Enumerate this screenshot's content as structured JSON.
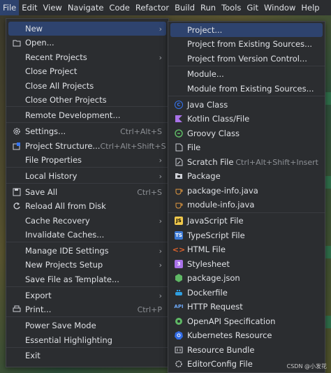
{
  "menubar": [
    {
      "label": "File",
      "active": true
    },
    {
      "label": "Edit"
    },
    {
      "label": "View"
    },
    {
      "label": "Navigate"
    },
    {
      "label": "Code"
    },
    {
      "label": "Refactor"
    },
    {
      "label": "Build"
    },
    {
      "label": "Run"
    },
    {
      "label": "Tools"
    },
    {
      "label": "Git"
    },
    {
      "label": "Window"
    },
    {
      "label": "Help"
    }
  ],
  "file_menu": [
    {
      "label": "New",
      "submenu": true,
      "highlighted": true
    },
    {
      "label": "Open...",
      "icon": "folder-icon"
    },
    {
      "label": "Recent Projects",
      "submenu": true
    },
    {
      "label": "Close Project"
    },
    {
      "label": "Close All Projects"
    },
    {
      "label": "Close Other Projects"
    },
    {
      "label": "Remote Development..."
    },
    {
      "label": "Settings...",
      "icon": "gear-icon",
      "shortcut": "Ctrl+Alt+S"
    },
    {
      "label": "Project Structure...",
      "icon": "project-structure-icon",
      "shortcut": "Ctrl+Alt+Shift+S"
    },
    {
      "label": "File Properties",
      "submenu": true
    },
    {
      "label": "Local History",
      "submenu": true
    },
    {
      "label": "Save All",
      "icon": "save-icon",
      "shortcut": "Ctrl+S"
    },
    {
      "label": "Reload All from Disk",
      "icon": "reload-icon"
    },
    {
      "label": "Cache Recovery",
      "submenu": true
    },
    {
      "label": "Invalidate Caches..."
    },
    {
      "label": "Manage IDE Settings",
      "submenu": true
    },
    {
      "label": "New Projects Setup",
      "submenu": true
    },
    {
      "label": "Save File as Template..."
    },
    {
      "label": "Export",
      "submenu": true
    },
    {
      "label": "Print...",
      "icon": "print-icon",
      "shortcut": "Ctrl+P"
    },
    {
      "label": "Power Save Mode"
    },
    {
      "label": "Essential Highlighting"
    },
    {
      "label": "Exit"
    }
  ],
  "new_submenu": [
    {
      "label": "Project...",
      "highlighted": true
    },
    {
      "label": "Project from Existing Sources..."
    },
    {
      "label": "Project from Version Control..."
    },
    {
      "label": "Module..."
    },
    {
      "label": "Module from Existing Sources..."
    },
    {
      "label": "Java Class",
      "icon": "java-class-icon"
    },
    {
      "label": "Kotlin Class/File",
      "icon": "kotlin-icon"
    },
    {
      "label": "Groovy Class",
      "icon": "groovy-icon"
    },
    {
      "label": "File",
      "icon": "file-icon"
    },
    {
      "label": "Scratch File",
      "icon": "scratch-file-icon",
      "shortcut": "Ctrl+Alt+Shift+Insert"
    },
    {
      "label": "Package",
      "icon": "package-icon"
    },
    {
      "label": "package-info.java",
      "icon": "java-info-icon"
    },
    {
      "label": "module-info.java",
      "icon": "java-info-icon"
    },
    {
      "label": "JavaScript File",
      "icon": "javascript-icon"
    },
    {
      "label": "TypeScript File",
      "icon": "typescript-icon"
    },
    {
      "label": "HTML File",
      "icon": "html-icon"
    },
    {
      "label": "Stylesheet",
      "icon": "css-icon"
    },
    {
      "label": "package.json",
      "icon": "nodejs-icon"
    },
    {
      "label": "Dockerfile",
      "icon": "docker-icon"
    },
    {
      "label": "HTTP Request",
      "icon": "api-icon"
    },
    {
      "label": "OpenAPI Specification",
      "icon": "openapi-icon"
    },
    {
      "label": "Kubernetes Resource",
      "icon": "kubernetes-icon"
    },
    {
      "label": "Resource Bundle",
      "icon": "resource-bundle-icon"
    },
    {
      "label": "EditorConfig File",
      "icon": "editorconfig-icon"
    }
  ],
  "icon_glyphs": {
    "api-icon": "API",
    "java-class-icon": "C",
    "typescript-icon": "TS",
    "javascript-icon": "JS",
    "css-icon": "3"
  },
  "watermark": "CSDN @小发花",
  "colors": {
    "highlight": "#2e436e",
    "menu_bg": "#2b2d30",
    "java": "#3574f0",
    "kotlin": "#a972e8",
    "js": "#f0c84b",
    "ts": "#3b79d6",
    "html": "#e3642c"
  }
}
